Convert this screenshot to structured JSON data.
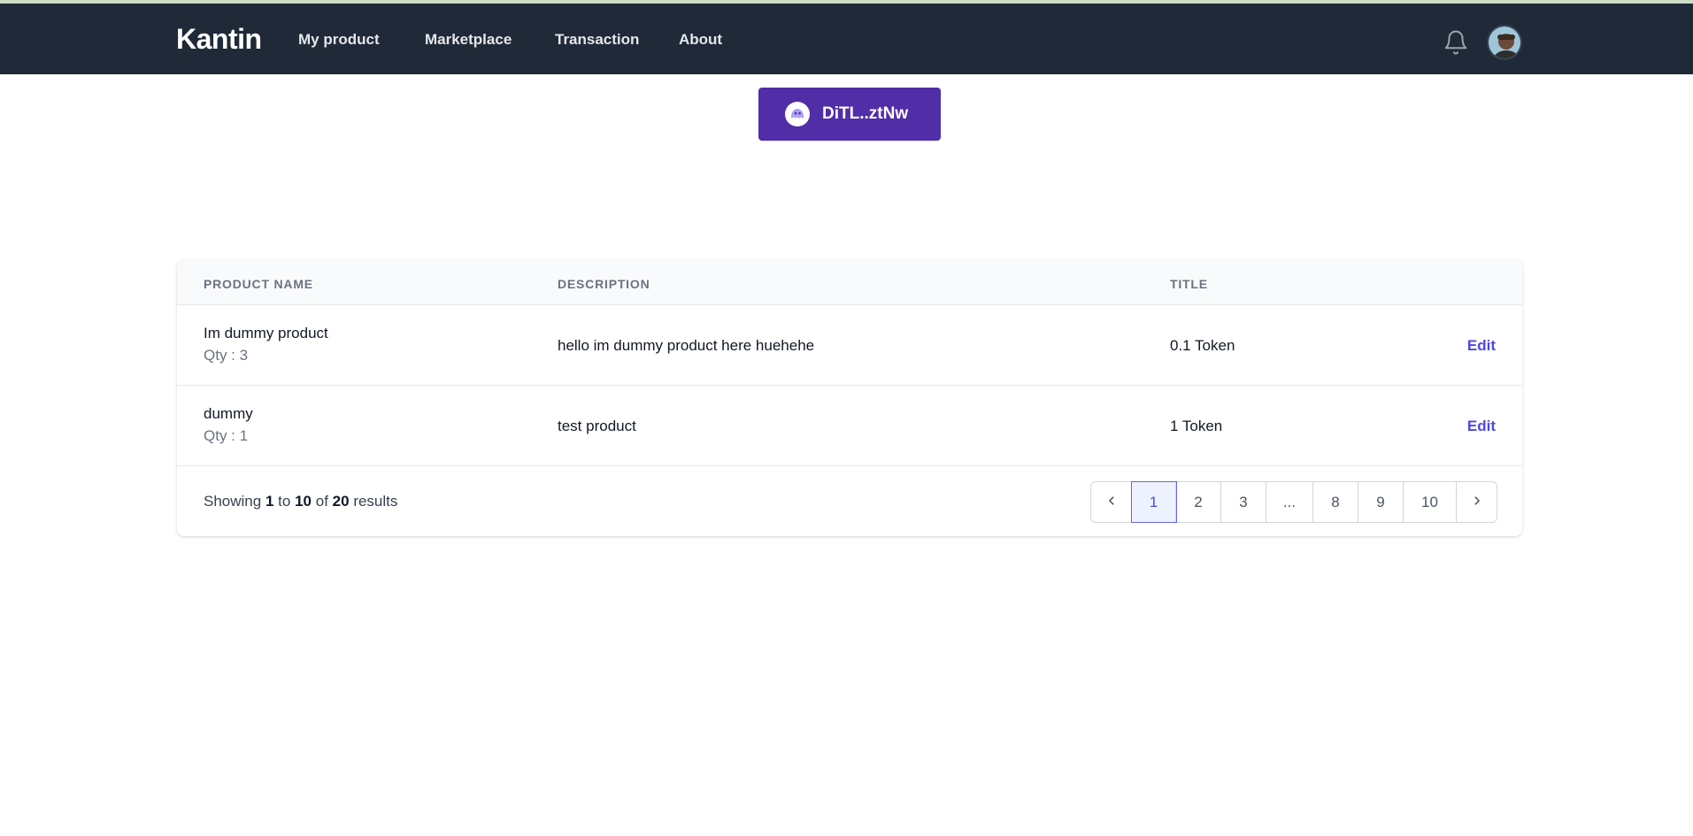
{
  "app": {
    "brand": "Kantin"
  },
  "nav": {
    "items": [
      {
        "label": "My product"
      },
      {
        "label": "Marketplace"
      },
      {
        "label": "Transaction"
      },
      {
        "label": "About"
      }
    ],
    "notification_icon": "bell-icon",
    "avatar_icon": "user-avatar"
  },
  "wallet": {
    "label": "DiTL..ztNw",
    "icon": "phantom-ghost-icon",
    "color": "#512da8"
  },
  "table": {
    "headers": {
      "name": "PRODUCT NAME",
      "description": "DESCRIPTION",
      "title": "TITLE"
    },
    "rows": [
      {
        "name": "Im dummy product",
        "qty": "Qty : 3",
        "description": "hello im dummy product here huehehe",
        "price": "0.1 Token",
        "action": "Edit"
      },
      {
        "name": "dummy",
        "qty": "Qty : 1",
        "description": "test product",
        "price": "1 Token",
        "action": "Edit"
      }
    ]
  },
  "pagination": {
    "showing_prefix": "Showing",
    "from": "1",
    "to_word": "to",
    "to": "10",
    "of_word": "of",
    "total": "20",
    "results_word": "results",
    "pages": [
      "1",
      "2",
      "3",
      "...",
      "8",
      "9",
      "10"
    ],
    "current": "1"
  },
  "colors": {
    "navbar": "#1f2937",
    "accent": "#4f46e5"
  }
}
